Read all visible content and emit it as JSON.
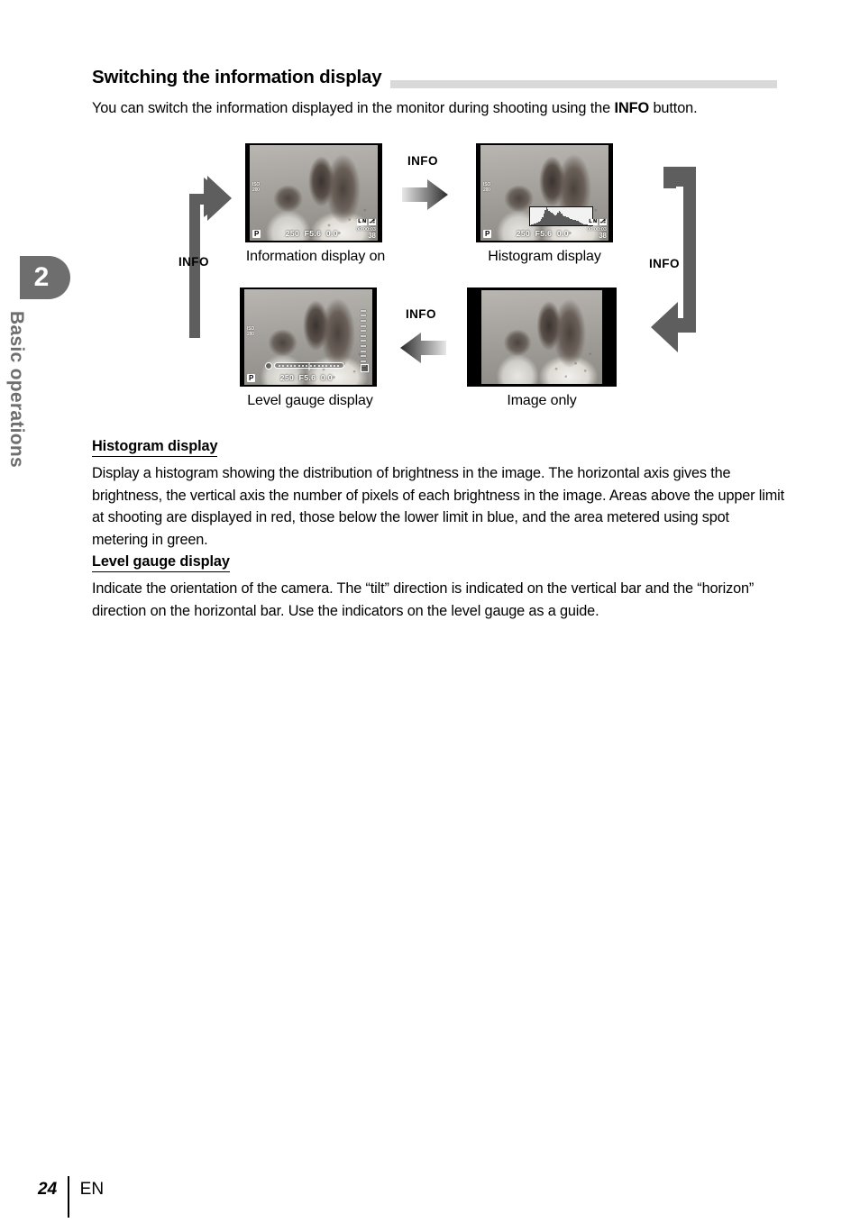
{
  "chapter": {
    "number": "2",
    "title": "Basic operations"
  },
  "heading": "Switching the information display",
  "intro": {
    "line1": "You can switch the information displayed in the monitor during shooting using the",
    "emphasis": "INFO",
    "line2": " button."
  },
  "diagram": {
    "info_label": "INFO",
    "captions": {
      "info_on": "Information display on",
      "histogram": "Histogram display",
      "level_gauge": "Level gauge display",
      "image_only": "Image only"
    },
    "hud": {
      "iso_label": "ISO",
      "iso_value": "200",
      "mode": "P",
      "shutter": "250",
      "aperture": "F5.6",
      "compensation": "0.0",
      "quality_badge": "L N",
      "card_badge": "⎇",
      "time_remaining": "00:00:03",
      "shots_remaining": "38"
    },
    "histogram_values": [
      4,
      5,
      7,
      9,
      12,
      10,
      14,
      18,
      26,
      36,
      52,
      68,
      80,
      72,
      63,
      58,
      54,
      50,
      47,
      44,
      48,
      55,
      62,
      58,
      50,
      44,
      40,
      38,
      36,
      34,
      31,
      29,
      27,
      25,
      23,
      22,
      20,
      18,
      15,
      12,
      9,
      7,
      5,
      4,
      3,
      2,
      2,
      1
    ]
  },
  "sections": [
    {
      "heading": "Histogram display",
      "body": "Display a histogram showing the distribution of brightness in the image. The horizontal axis gives the brightness, the vertical axis the number of pixels of each brightness in the image. Areas above the upper limit at shooting are displayed in red, those below the lower limit in blue, and the area metered using spot metering in green."
    },
    {
      "heading": "Level gauge display",
      "body": "Indicate the orientation of the camera. The “tilt” direction is indicated on the vertical bar and the “horizon” direction on the horizontal bar. Use the indicators on the level gauge as a guide."
    }
  ],
  "footer": {
    "page_number": "24",
    "language": "EN"
  },
  "colors": {
    "arrow_gray": "#5e5e5e",
    "heading_rule": "#d9d9d9",
    "chapter_gray": "#6e6e6e"
  }
}
